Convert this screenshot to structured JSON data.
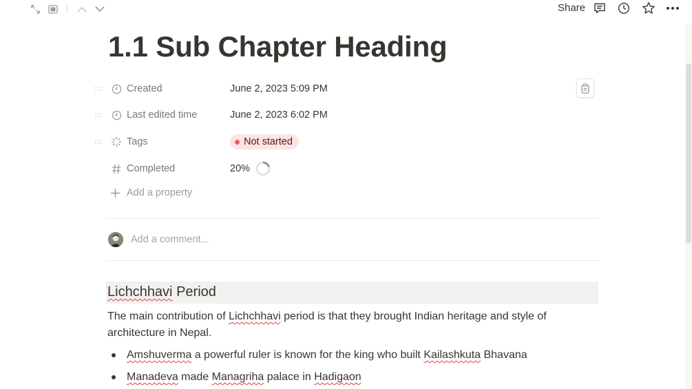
{
  "topbar": {
    "share_label": "Share"
  },
  "page": {
    "title": "1.1 Sub Chapter Heading"
  },
  "properties": [
    {
      "label": "Created",
      "value": "June 2, 2023 5:09 PM",
      "icon": "clock-icon"
    },
    {
      "label": "Last edited time",
      "value": "June 2, 2023 6:02 PM",
      "icon": "clock-icon"
    },
    {
      "label": "Tags",
      "value": "Not started",
      "icon": "loader-icon",
      "tag_color": "#fbe4e4"
    },
    {
      "label": "Completed",
      "value": "20%",
      "icon": "hash-icon",
      "progress": 0.2
    }
  ],
  "add_property_label": "Add a property",
  "comment": {
    "placeholder": "Add a comment..."
  },
  "content": {
    "heading_word1": "Lichchhavi",
    "heading_word2": " Period",
    "para_part1": "The main contribution of ",
    "para_misspelled": "Lichchhavi",
    "para_part2": " period is that they brought Indian heritage and style of architecture in Nepal.",
    "bullet1": {
      "w1": "Amshuverma",
      "t1": " a powerful ruler is known for the king who built ",
      "w2": "Kailashkuta",
      "t2": " Bhavana"
    },
    "bullet2": {
      "w1": "Manadeva",
      "t1": " made ",
      "w2": "Managriha",
      "t2": " palace in ",
      "w3": "Hadigaon"
    }
  },
  "colors": {
    "text": "#37352f",
    "muted": "#9b9a97",
    "tag_bg": "#fbe4e4",
    "tag_dot": "#e16259",
    "progress": "#6b9a7a"
  }
}
